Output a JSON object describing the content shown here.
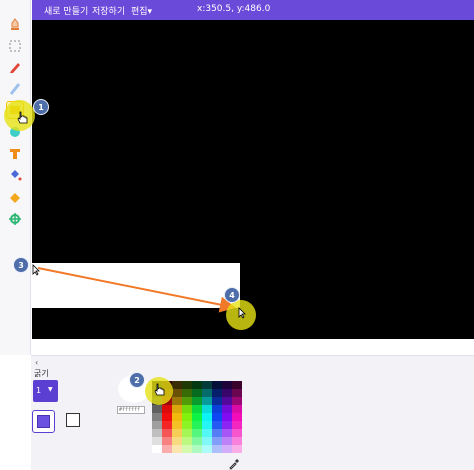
{
  "menu": {
    "new_label": "새로 만들기",
    "save_label": "저장하기",
    "edit_label": "편집▾",
    "coords": "x:350.5, y:486.0"
  },
  "tools": [
    {
      "name": "stamp-tool",
      "icon": "stamp-icon",
      "color": "#f4a259"
    },
    {
      "name": "select-tool",
      "icon": "select-dashed-icon",
      "color": "#888888"
    },
    {
      "name": "pen-tool",
      "icon": "pencil-icon",
      "color": "#e0453a"
    },
    {
      "name": "line-tool",
      "icon": "line-icon",
      "color": "#7aa7e0"
    },
    {
      "name": "rectangle-tool",
      "icon": "rectangle-icon",
      "color": "#f2c400",
      "selected": true
    },
    {
      "name": "ellipse-tool",
      "icon": "circle-icon",
      "color": "#3ecfc9"
    },
    {
      "name": "text-tool",
      "icon": "text-icon",
      "color": "#f08c1a"
    },
    {
      "name": "fill-tool",
      "icon": "fill-bucket-icon",
      "color": "#4a6ad8"
    },
    {
      "name": "eraser-tool",
      "icon": "eraser-icon",
      "color": "#f2a81a"
    },
    {
      "name": "center-tool",
      "icon": "crosshair-icon",
      "color": "#2bb673"
    }
  ],
  "panel": {
    "collapse_glyph": "‹",
    "thickness_label": "굵기",
    "thickness_value": "1",
    "hex_placeholder": "#ffffff"
  },
  "colors": {
    "menubar": "#6a4ad8",
    "accent": "#5b3fd3",
    "badge": "#4d6ea8",
    "highlight": "#e6e114",
    "arrow": "#f07a2a"
  },
  "annotations": [
    {
      "label": "1"
    },
    {
      "label": "2"
    },
    {
      "label": "3"
    },
    {
      "label": "4"
    }
  ]
}
